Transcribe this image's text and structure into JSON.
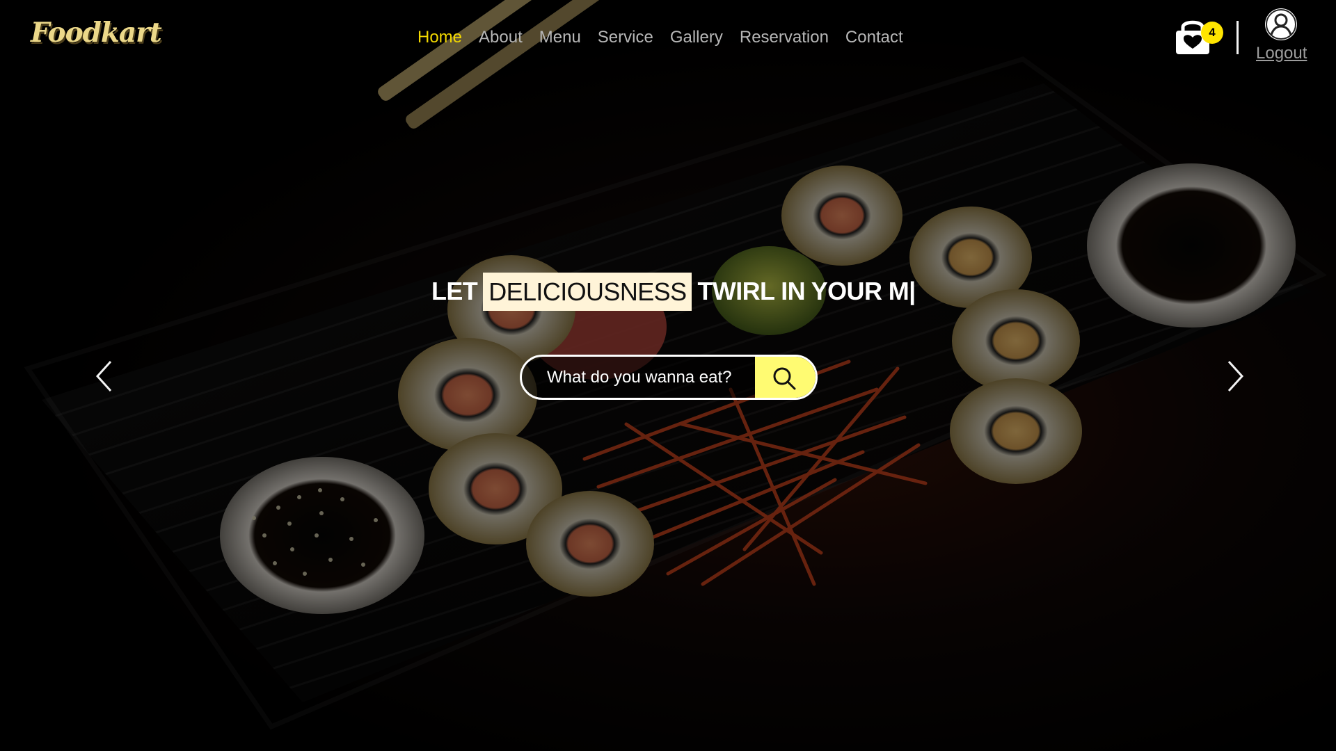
{
  "page": {
    "brand": "Foodkart",
    "nav": {
      "links": [
        {
          "label": "Home",
          "active": true
        },
        {
          "label": "About",
          "active": false
        },
        {
          "label": "Menu",
          "active": false
        },
        {
          "label": "Service",
          "active": false
        },
        {
          "label": "Gallery",
          "active": false
        },
        {
          "label": "Reservation",
          "active": false
        },
        {
          "label": "Contact",
          "active": false
        }
      ],
      "cart": {
        "count": "4",
        "icon": "shopping-bag-heart-icon"
      },
      "profile": {
        "icon": "user-avatar-icon",
        "logout_label": "Logout"
      }
    },
    "hero": {
      "headline_start": "LET",
      "headline_highlight": "DELICIOUSNESS",
      "headline_end": "TWIRL IN YOUR M|",
      "search_placeholder": "What do you wanna eat?",
      "search_icon": "search-icon",
      "prev_icon": "chevron-left-icon",
      "next_icon": "chevron-right-icon"
    },
    "colors": {
      "active_nav": "#f2d800",
      "badge": "#ffe500",
      "search_button": "#fffb72",
      "highlight": "#fff4d8"
    }
  }
}
